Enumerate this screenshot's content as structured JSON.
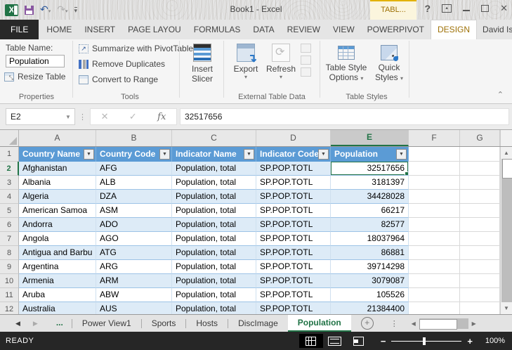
{
  "colors": {
    "accent_green": "#217346",
    "table_header_blue": "#5B9BD5",
    "band_blue": "#DDEBF7",
    "contextual_gold": "#9e7106",
    "status_bar_bg": "#262626",
    "file_tab_bg": "#282828"
  },
  "title_bar": {
    "title": "Book1 - Excel",
    "contextual_tab_label": "TABL...",
    "user_name": "David Ise..."
  },
  "ribbon_tabs": [
    {
      "label": "FILE",
      "style": "file"
    },
    {
      "label": "HOME",
      "style": "normal"
    },
    {
      "label": "INSERT",
      "style": "normal"
    },
    {
      "label": "PAGE LAYOU",
      "style": "normal"
    },
    {
      "label": "FORMULAS",
      "style": "normal"
    },
    {
      "label": "DATA",
      "style": "normal"
    },
    {
      "label": "REVIEW",
      "style": "normal"
    },
    {
      "label": "VIEW",
      "style": "normal"
    },
    {
      "label": "POWERPIVOT",
      "style": "normal"
    },
    {
      "label": "DESIGN",
      "style": "active"
    }
  ],
  "ribbon": {
    "properties": {
      "group_label": "Properties",
      "table_name_label": "Table Name:",
      "table_name_value": "Population",
      "resize_table_label": "Resize Table"
    },
    "tools": {
      "group_label": "Tools",
      "summarize_label": "Summarize with PivotTable",
      "remove_duplicates_label": "Remove Duplicates",
      "convert_to_range_label": "Convert to Range"
    },
    "slicer": {
      "line1": "Insert",
      "line2": "Slicer"
    },
    "external": {
      "group_label": "External Table Data",
      "export_label": "Export",
      "refresh_label": "Refresh"
    },
    "table_styles": {
      "group_label": "Table Styles",
      "options_line1": "Table Style",
      "options_line2": "Options",
      "quick_line1": "Quick",
      "quick_line2": "Styles"
    }
  },
  "formula_bar": {
    "name_box_value": "E2",
    "formula_value": "32517656"
  },
  "grid": {
    "column_letters": [
      "A",
      "B",
      "C",
      "D",
      "E",
      "F",
      "G"
    ],
    "selected_column": "E",
    "selected_row": "2",
    "first_row_number": "1",
    "table_headers": [
      "Country Name",
      "Country Code",
      "Indicator Name",
      "Indicator Code",
      "Population"
    ],
    "rows": [
      {
        "n": "2",
        "country_name": "Afghanistan",
        "country_code": "AFG",
        "indicator_name": "Population, total",
        "indicator_code": "SP.POP.TOTL",
        "population": "32517656"
      },
      {
        "n": "3",
        "country_name": "Albania",
        "country_code": "ALB",
        "indicator_name": "Population, total",
        "indicator_code": "SP.POP.TOTL",
        "population": "3181397"
      },
      {
        "n": "4",
        "country_name": "Algeria",
        "country_code": "DZA",
        "indicator_name": "Population, total",
        "indicator_code": "SP.POP.TOTL",
        "population": "34428028"
      },
      {
        "n": "5",
        "country_name": "American Samoa",
        "country_code": "ASM",
        "indicator_name": "Population, total",
        "indicator_code": "SP.POP.TOTL",
        "population": "66217"
      },
      {
        "n": "6",
        "country_name": "Andorra",
        "country_code": "ADO",
        "indicator_name": "Population, total",
        "indicator_code": "SP.POP.TOTL",
        "population": "82577"
      },
      {
        "n": "7",
        "country_name": "Angola",
        "country_code": "AGO",
        "indicator_name": "Population, total",
        "indicator_code": "SP.POP.TOTL",
        "population": "18037964"
      },
      {
        "n": "8",
        "country_name": "Antigua and Barbu",
        "country_code": "ATG",
        "indicator_name": "Population, total",
        "indicator_code": "SP.POP.TOTL",
        "population": "86881"
      },
      {
        "n": "9",
        "country_name": "Argentina",
        "country_code": "ARG",
        "indicator_name": "Population, total",
        "indicator_code": "SP.POP.TOTL",
        "population": "39714298"
      },
      {
        "n": "10",
        "country_name": "Armenia",
        "country_code": "ARM",
        "indicator_name": "Population, total",
        "indicator_code": "SP.POP.TOTL",
        "population": "3079087"
      },
      {
        "n": "11",
        "country_name": "Aruba",
        "country_code": "ABW",
        "indicator_name": "Population, total",
        "indicator_code": "SP.POP.TOTL",
        "population": "105526"
      },
      {
        "n": "12",
        "country_name": "Australia",
        "country_code": "AUS",
        "indicator_name": "Population, total",
        "indicator_code": "SP.POP.TOTL",
        "population": "21384400"
      }
    ]
  },
  "sheet_bar": {
    "overflow_label": "...",
    "tabs": [
      "Power View1",
      "Sports",
      "Hosts",
      "DiscImage",
      "Population"
    ],
    "active_tab": "Population"
  },
  "status_bar": {
    "mode": "READY",
    "zoom_level": "100%"
  }
}
